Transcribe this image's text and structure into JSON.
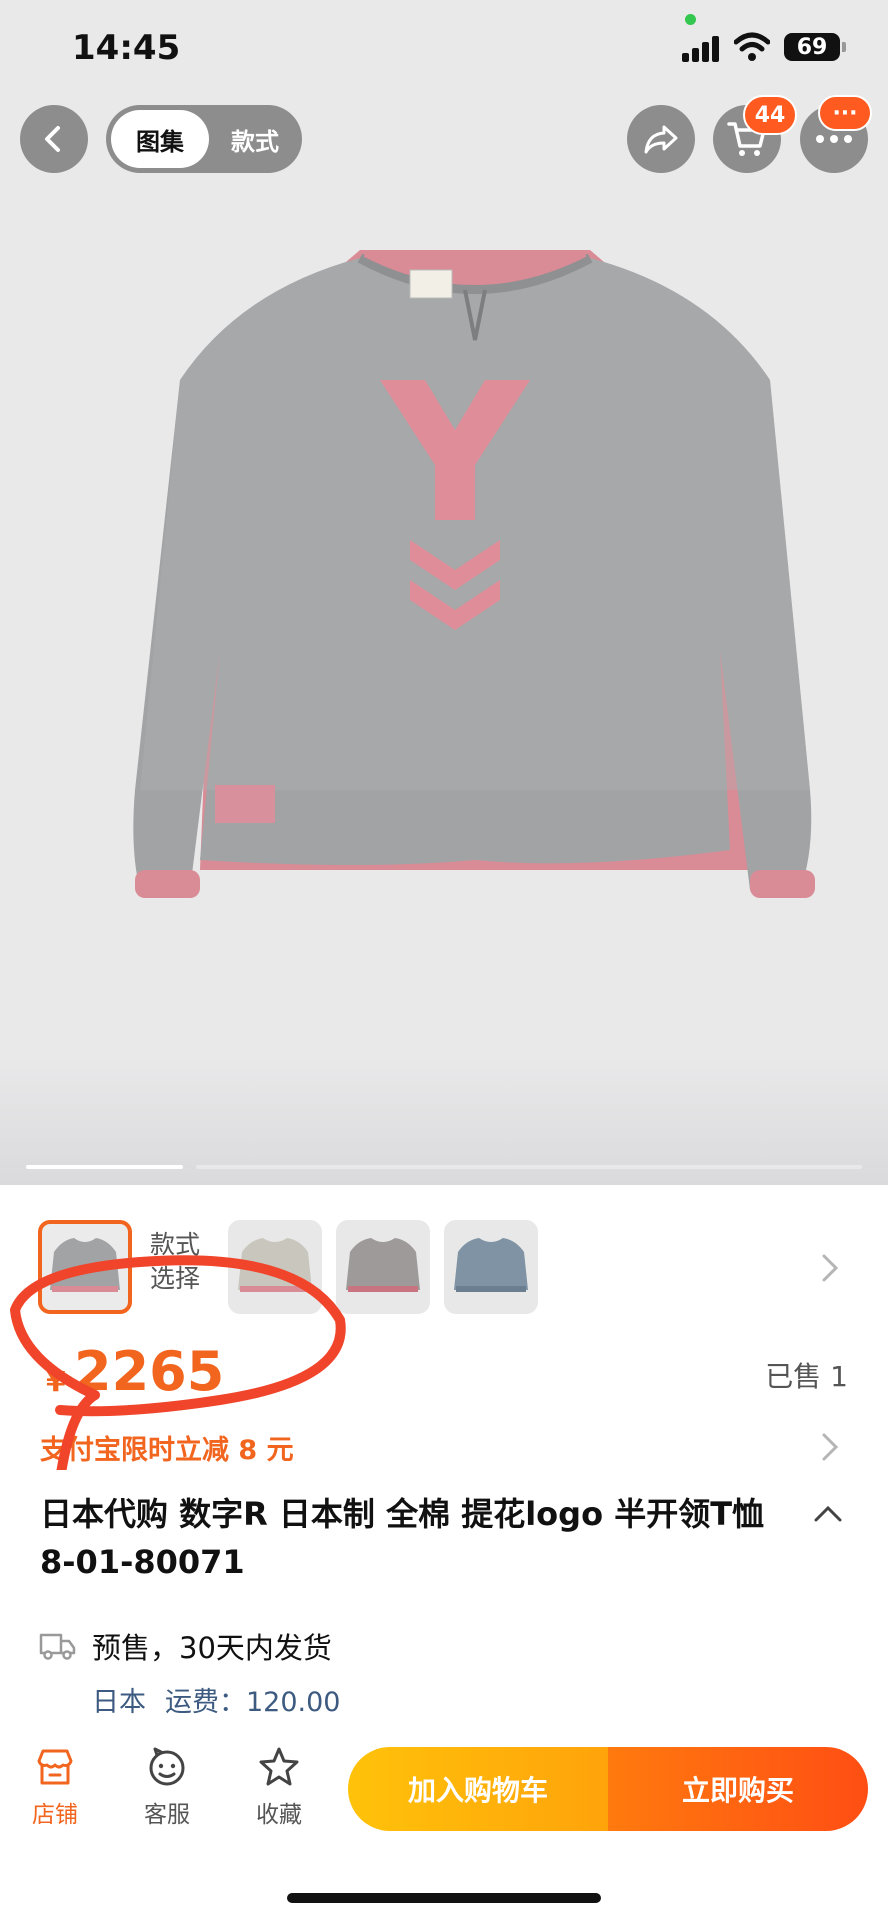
{
  "status_bar": {
    "time": "14:45",
    "battery": "69",
    "icons": [
      "signal-icon",
      "wifi-icon",
      "battery-icon"
    ]
  },
  "top_nav": {
    "tabs": [
      {
        "label": "图集",
        "active": true
      },
      {
        "label": "款式",
        "active": false
      }
    ],
    "cart_badge": "44",
    "more_badge": "···",
    "icons": [
      "back-icon",
      "share-icon",
      "cart-icon",
      "more-icon"
    ]
  },
  "gallery": {
    "current_page_fraction": 0.2,
    "image": "gray long-sleeve henley tee with pink Y print"
  },
  "variants": {
    "label": "款式选择",
    "count_shown": 4,
    "selected_index": 0
  },
  "price": {
    "symbol": "¥",
    "value": "2265",
    "sold": "已售 1"
  },
  "promo": {
    "text": "支付宝限时立减 8 元"
  },
  "product": {
    "title": "日本代购 数字R 日本制 全棉 提花logo 半开领T恤 8-01-80071"
  },
  "shipping": {
    "text": "预售，30天内发货",
    "origin": "日本",
    "fee": "运费：120.00"
  },
  "bottom_bar": {
    "tabs": [
      {
        "label": "店铺",
        "icon": "store-icon"
      },
      {
        "label": "客服",
        "icon": "customer-service-icon"
      },
      {
        "label": "收藏",
        "icon": "star-icon"
      }
    ],
    "add_to_cart": "加入购物车",
    "buy_now": "立即购买"
  },
  "colors": {
    "accent": "#f2651e",
    "cart_button": "#ffb20a",
    "buy_button": "#ff5a14"
  }
}
